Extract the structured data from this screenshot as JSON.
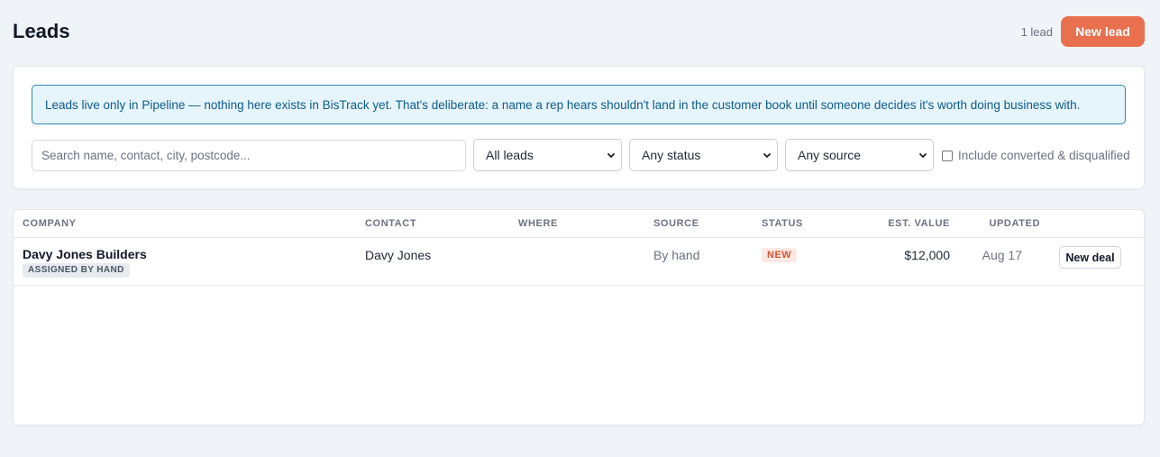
{
  "header": {
    "title": "Leads",
    "lead_count": "1 lead",
    "new_lead_label": "New lead"
  },
  "colors": {
    "accent": "#e8704f",
    "info_bg": "#e6f4fb",
    "info_border": "#2f88b8",
    "status_new": "#d4532f"
  },
  "filters": {
    "banner": "Leads live only in Pipeline — nothing here exists in BisTrack yet. That's deliberate: a name a rep hears shouldn't land in the customer book until someone decides it's worth doing business with.",
    "search_placeholder": "Search name, contact, city, postcode...",
    "scope_selected": "All leads",
    "status_selected": "Any status",
    "source_selected": "Any source",
    "include_label": "Include converted & disqualified"
  },
  "table": {
    "columns": {
      "company": "COMPANY",
      "contact": "CONTACT",
      "where": "WHERE",
      "source": "SOURCE",
      "status": "STATUS",
      "value": "EST. VALUE",
      "updated": "UPDATED"
    },
    "rows": [
      {
        "company": "Davy Jones Builders",
        "assignment": "ASSIGNED BY HAND",
        "contact": "Davy Jones",
        "where": "",
        "source": "By hand",
        "status": "NEW",
        "value": "$12,000",
        "updated": "Aug 17",
        "action": "New deal"
      }
    ]
  }
}
